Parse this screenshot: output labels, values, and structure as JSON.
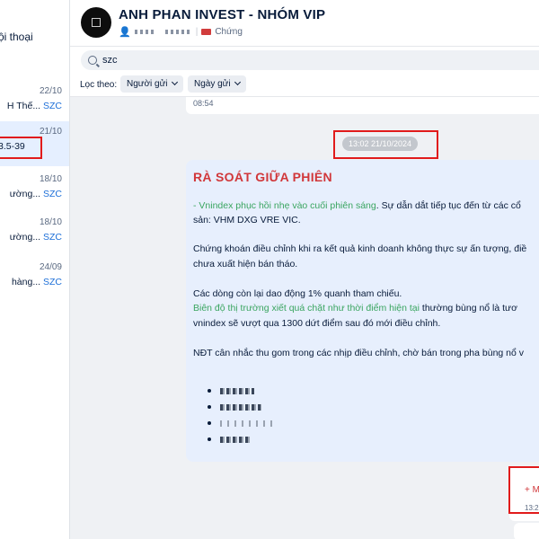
{
  "sidebar": {
    "title_fragment": "ội thoại",
    "conversations": [
      {
        "date": "22/10",
        "snippet_pre": "H Thế... ",
        "snippet_hl": "SZC",
        "active": false
      },
      {
        "date": "21/10",
        "snippet_pre": "3.5-39",
        "snippet_hl": "",
        "active": true
      },
      {
        "date": "18/10",
        "snippet_pre": "ường... ",
        "snippet_hl": "SZC",
        "active": false
      },
      {
        "date": "18/10",
        "snippet_pre": "ường... ",
        "snippet_hl": "SZC",
        "active": false
      },
      {
        "date": "24/09",
        "snippet_pre": "hàng... ",
        "snippet_hl": "SZC",
        "active": false
      }
    ]
  },
  "header": {
    "group_name": "ANH PHAN INVEST - NHÓM VIP",
    "tag_label": "Chứng"
  },
  "search": {
    "query": "szc"
  },
  "filter": {
    "label": "Lọc theo:",
    "sender": "Người gửi",
    "date": "Ngày gửi"
  },
  "chat": {
    "prev_time": "08:54",
    "date_pill": "13:02 21/10/2024",
    "message": {
      "title": "RÀ SOÁT GIỮA PHIÊN",
      "l1_dash": "- ",
      "l1_green": "Vnindex phục hồi nhẹ vào cuối phiên sáng",
      "l1_rest": ". Sự dẫn dắt tiếp tục đến từ các cổ",
      "l2": "sản: VHM DXG VRE VIC.",
      "l3": "Chứng khoán điều chỉnh khi ra kết quả kinh doanh không thực sự ấn tượng, điề",
      "l4": "chưa xuất hiện bán tháo.",
      "l5": "Các dòng còn lại dao động 1% quanh tham chiếu.",
      "l6_green": "Biên độ thị trường xiết quá chặt như thời điểm hiện tại",
      "l6_rest": " thường bùng nổ là tươ",
      "l7": "vnindex sẽ vượt qua 1300 dứt điểm sau đó mới điều chỉnh.",
      "l8": "NĐT cân nhắc thu gom trong các nhịp điều chỉnh, chờ bán trong pha bùng nổ v"
    },
    "more_label": "+ M",
    "more_time": "13:2"
  }
}
